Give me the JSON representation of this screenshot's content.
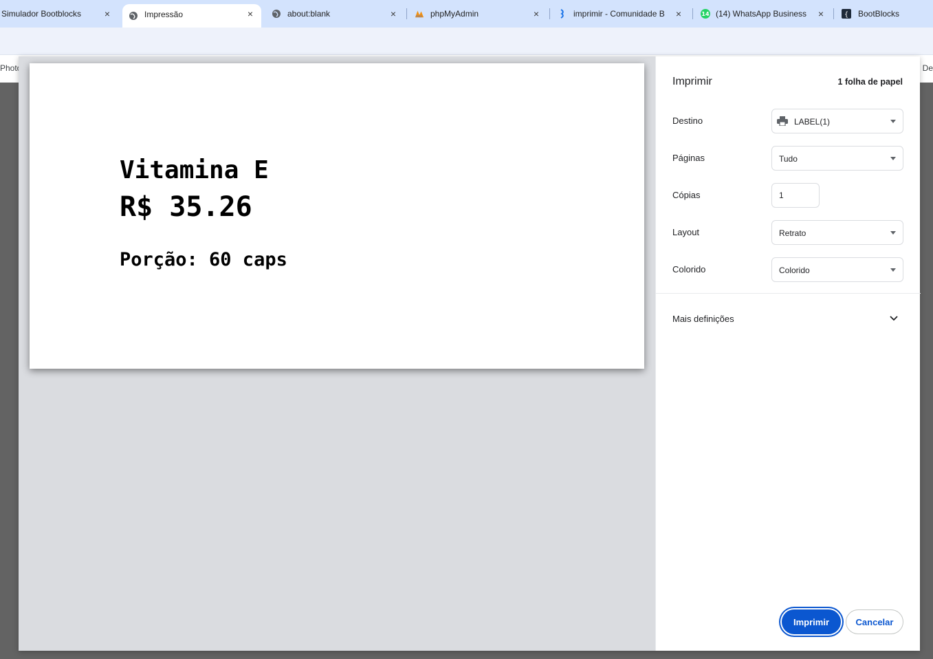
{
  "tabs": [
    {
      "title": "Simulador Bootblocks",
      "icon": "bootblocks-icon",
      "close": "×"
    },
    {
      "title": "Impressão",
      "icon": "globe-icon",
      "close": "×",
      "active": true
    },
    {
      "title": "about:blank",
      "icon": "globe-icon",
      "close": "×"
    },
    {
      "title": "phpMyAdmin",
      "icon": "phpmyadmin-icon",
      "close": "×"
    },
    {
      "title": "imprimir - Comunidade B",
      "icon": "community-icon",
      "close": "×"
    },
    {
      "title": "(14) WhatsApp Business",
      "icon": "whatsapp-icon",
      "badge": "14",
      "close": "×"
    },
    {
      "title": "BootBlocks",
      "icon": "bootblocks-icon"
    }
  ],
  "bookmarks": {
    "left_fragment": "Photo",
    "right_fragment": "De"
  },
  "preview": {
    "name": "Vitamina E",
    "price": "R$ 35.26",
    "portion": "Porção: 60 caps"
  },
  "print": {
    "title": "Imprimir",
    "sheets": "1 folha de papel",
    "destination_label": "Destino",
    "destination_value": "LABEL(1)",
    "pages_label": "Páginas",
    "pages_value": "Tudo",
    "copies_label": "Cópias",
    "copies_value": "1",
    "layout_label": "Layout",
    "layout_value": "Retrato",
    "color_label": "Colorido",
    "color_value": "Colorido",
    "more_settings": "Mais definições",
    "print_button": "Imprimir",
    "cancel_button": "Cancelar"
  },
  "colors": {
    "accent": "#0b57d0",
    "tabstrip": "#d3e3fd",
    "preview_bg": "#dadce0"
  }
}
